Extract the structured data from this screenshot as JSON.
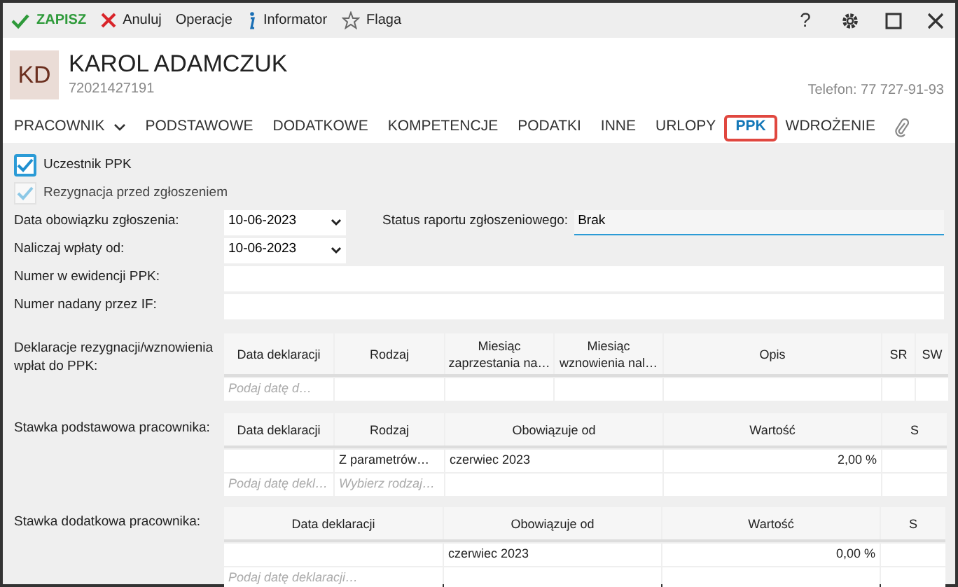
{
  "toolbar": {
    "actions": [
      {
        "label": "ZAPISZ",
        "kind": "save"
      },
      {
        "label": "Anuluj",
        "kind": "cancel"
      },
      {
        "label": "Operacje",
        "kind": "menu"
      },
      {
        "label": "Informator",
        "kind": "info"
      },
      {
        "label": "Flaga",
        "kind": "flag"
      }
    ],
    "help": "?"
  },
  "header": {
    "initials": "KD",
    "name": "KAROL ADAMCZUK",
    "id": "72021427191",
    "phone": "Telefon: 77 727-91-93"
  },
  "tabs": [
    {
      "label": "PRACOWNIK",
      "selected": false,
      "kind": "menu"
    },
    {
      "label": "PODSTAWOWE",
      "selected": false,
      "kind": "tab"
    },
    {
      "label": "DODATKOWE",
      "selected": false,
      "kind": "tab"
    },
    {
      "label": "KOMPETENCJE",
      "selected": false,
      "kind": "tab"
    },
    {
      "label": "PODATKI",
      "selected": false,
      "kind": "tab"
    },
    {
      "label": "INNE",
      "selected": false,
      "kind": "tab"
    },
    {
      "label": "URLOPY",
      "selected": false,
      "kind": "tab"
    },
    {
      "label": "PPK",
      "selected": true,
      "kind": "tab"
    },
    {
      "label": "WDROŻENIE",
      "selected": false,
      "kind": "tab"
    }
  ],
  "checkboxes": [
    {
      "label": "Uczestnik PPK",
      "checked": true,
      "disabled": false
    },
    {
      "label": "Rezygnacja przed zgłoszeniem",
      "checked": true,
      "disabled": true
    }
  ],
  "form": [
    {
      "fields": [
        {
          "label": "Data obowiązku zgłoszenia:",
          "value": "10-06-2023",
          "kind": "date"
        },
        {
          "label": "Status raportu zgłoszeniowego:",
          "value": "Brak",
          "kind": "status"
        }
      ]
    },
    {
      "fields": [
        {
          "label": "Naliczaj wpłaty od:",
          "value": "10-06-2023",
          "kind": "date"
        }
      ]
    },
    {
      "fields": [
        {
          "label": "Numer w ewidencji PPK:",
          "kind": "text"
        }
      ]
    },
    {
      "fields": [
        {
          "label": "Numer nadany przez IF:",
          "kind": "text"
        }
      ]
    }
  ],
  "tables": [
    {
      "label": "Deklaracje rezygnacji/wznowienia wpłat do PPK:",
      "columns": [
        {
          "label": "Data deklaracji"
        },
        {
          "label": "Rodzaj"
        },
        {
          "label": "Miesiąc zaprzestania na…"
        },
        {
          "label": "Miesiąc wznowienia nal…"
        },
        {
          "label": "Opis"
        },
        {
          "label": "SR"
        },
        {
          "label": "SW"
        }
      ],
      "rows": [
        {
          "kind": "new",
          "cells": [
            "Podaj datę d…",
            null,
            null,
            null,
            null,
            null,
            null
          ]
        }
      ]
    },
    {
      "label": "Stawka podstawowa pracownika:",
      "columns": [
        {
          "label": "Data deklaracji"
        },
        {
          "label": "Rodzaj"
        },
        {
          "label": "Obowiązuje od"
        },
        {
          "label": "Wartość",
          "kind": "number"
        },
        {
          "label": "S"
        }
      ],
      "rows": [
        {
          "kind": "data",
          "cells": [
            null,
            "Z parametrów…",
            "czerwiec 2023",
            "2,00 %",
            null
          ]
        },
        {
          "kind": "new",
          "cells": [
            "Podaj datę dekl…",
            "Wybierz rodzaj…",
            null,
            null,
            null
          ]
        }
      ]
    },
    {
      "label": "Stawka dodatkowa pracownika:",
      "columns": [
        {
          "label": "Data deklaracji"
        },
        {
          "label": "Obowiązuje od"
        },
        {
          "label": "Wartość",
          "kind": "number"
        },
        {
          "label": "S"
        }
      ],
      "rows": [
        {
          "kind": "data",
          "cells": [
            null,
            "czerwiec 2023",
            "0,00 %",
            null
          ]
        },
        {
          "kind": "new",
          "cells": [
            "Podaj datę deklaracji…",
            null,
            null,
            null
          ]
        }
      ]
    }
  ]
}
